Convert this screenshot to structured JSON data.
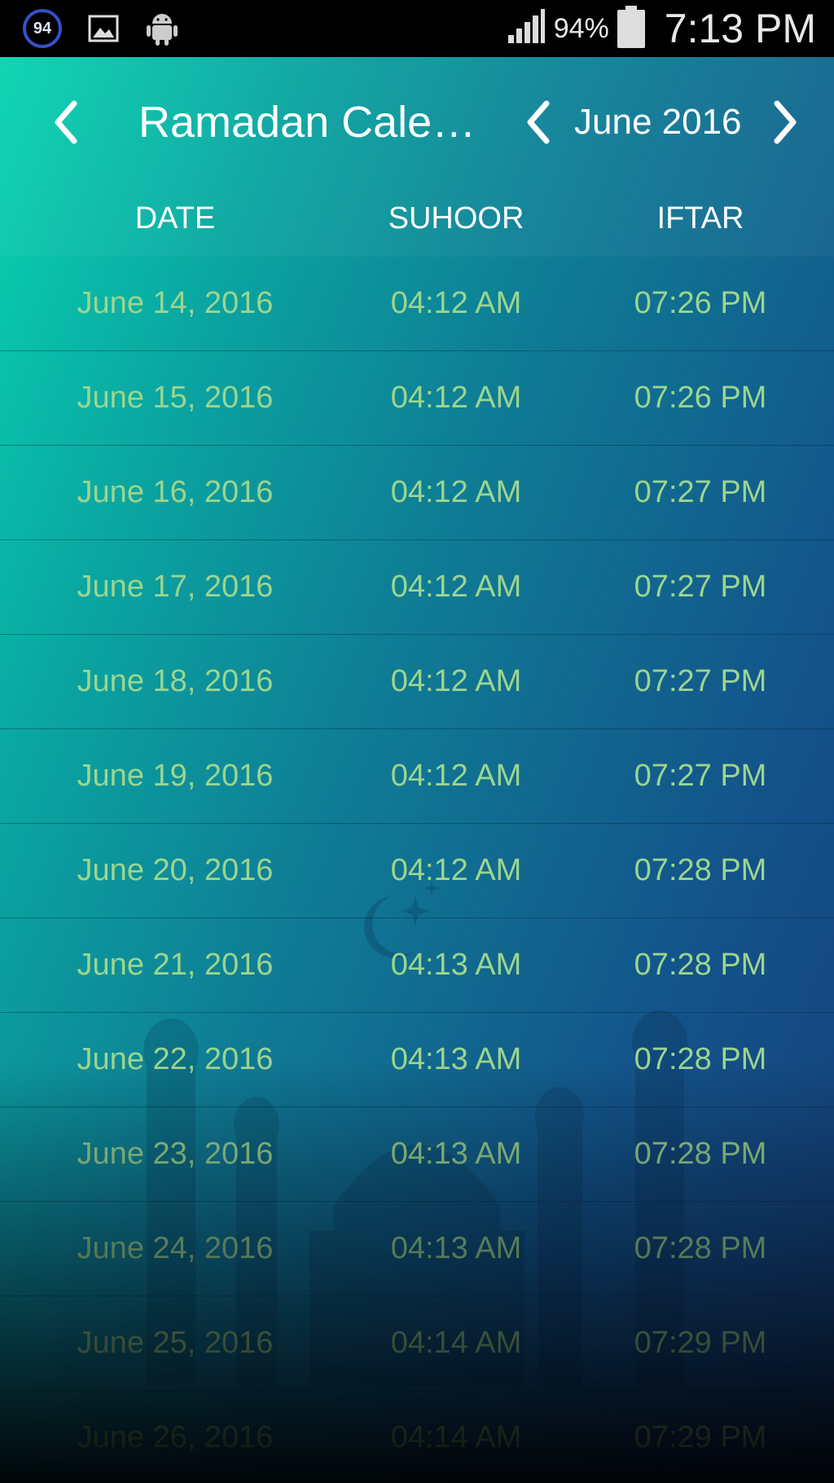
{
  "status_bar": {
    "badge_number": "94",
    "battery_percent": "94%",
    "time": "7:13 PM",
    "icons": [
      "notification-count-icon",
      "image-icon",
      "android-icon",
      "signal-icon",
      "battery-icon"
    ]
  },
  "header": {
    "title": "Ramadan Cale…",
    "month": "June 2016"
  },
  "columns": {
    "date": "DATE",
    "suhoor": "SUHOOR",
    "iftar": "IFTAR"
  },
  "rows": [
    {
      "date": "June 14, 2016",
      "suhoor": "04:12 AM",
      "iftar": "07:26 PM"
    },
    {
      "date": "June 15, 2016",
      "suhoor": "04:12 AM",
      "iftar": "07:26 PM"
    },
    {
      "date": "June 16, 2016",
      "suhoor": "04:12 AM",
      "iftar": "07:27 PM"
    },
    {
      "date": "June 17, 2016",
      "suhoor": "04:12 AM",
      "iftar": "07:27 PM"
    },
    {
      "date": "June 18, 2016",
      "suhoor": "04:12 AM",
      "iftar": "07:27 PM"
    },
    {
      "date": "June 19, 2016",
      "suhoor": "04:12 AM",
      "iftar": "07:27 PM"
    },
    {
      "date": "June 20, 2016",
      "suhoor": "04:12 AM",
      "iftar": "07:28 PM"
    },
    {
      "date": "June 21, 2016",
      "suhoor": "04:13 AM",
      "iftar": "07:28 PM"
    },
    {
      "date": "June 22, 2016",
      "suhoor": "04:13 AM",
      "iftar": "07:28 PM"
    },
    {
      "date": "June 23, 2016",
      "suhoor": "04:13 AM",
      "iftar": "07:28 PM"
    },
    {
      "date": "June 24, 2016",
      "suhoor": "04:13 AM",
      "iftar": "07:28 PM"
    },
    {
      "date": "June 25, 2016",
      "suhoor": "04:14 AM",
      "iftar": "07:29 PM"
    },
    {
      "date": "June 26, 2016",
      "suhoor": "04:14 AM",
      "iftar": "07:29 PM"
    }
  ],
  "colors": {
    "accent_text": "#9cd58e",
    "gradient_start": "#08d4b0",
    "gradient_end": "#163e78"
  }
}
